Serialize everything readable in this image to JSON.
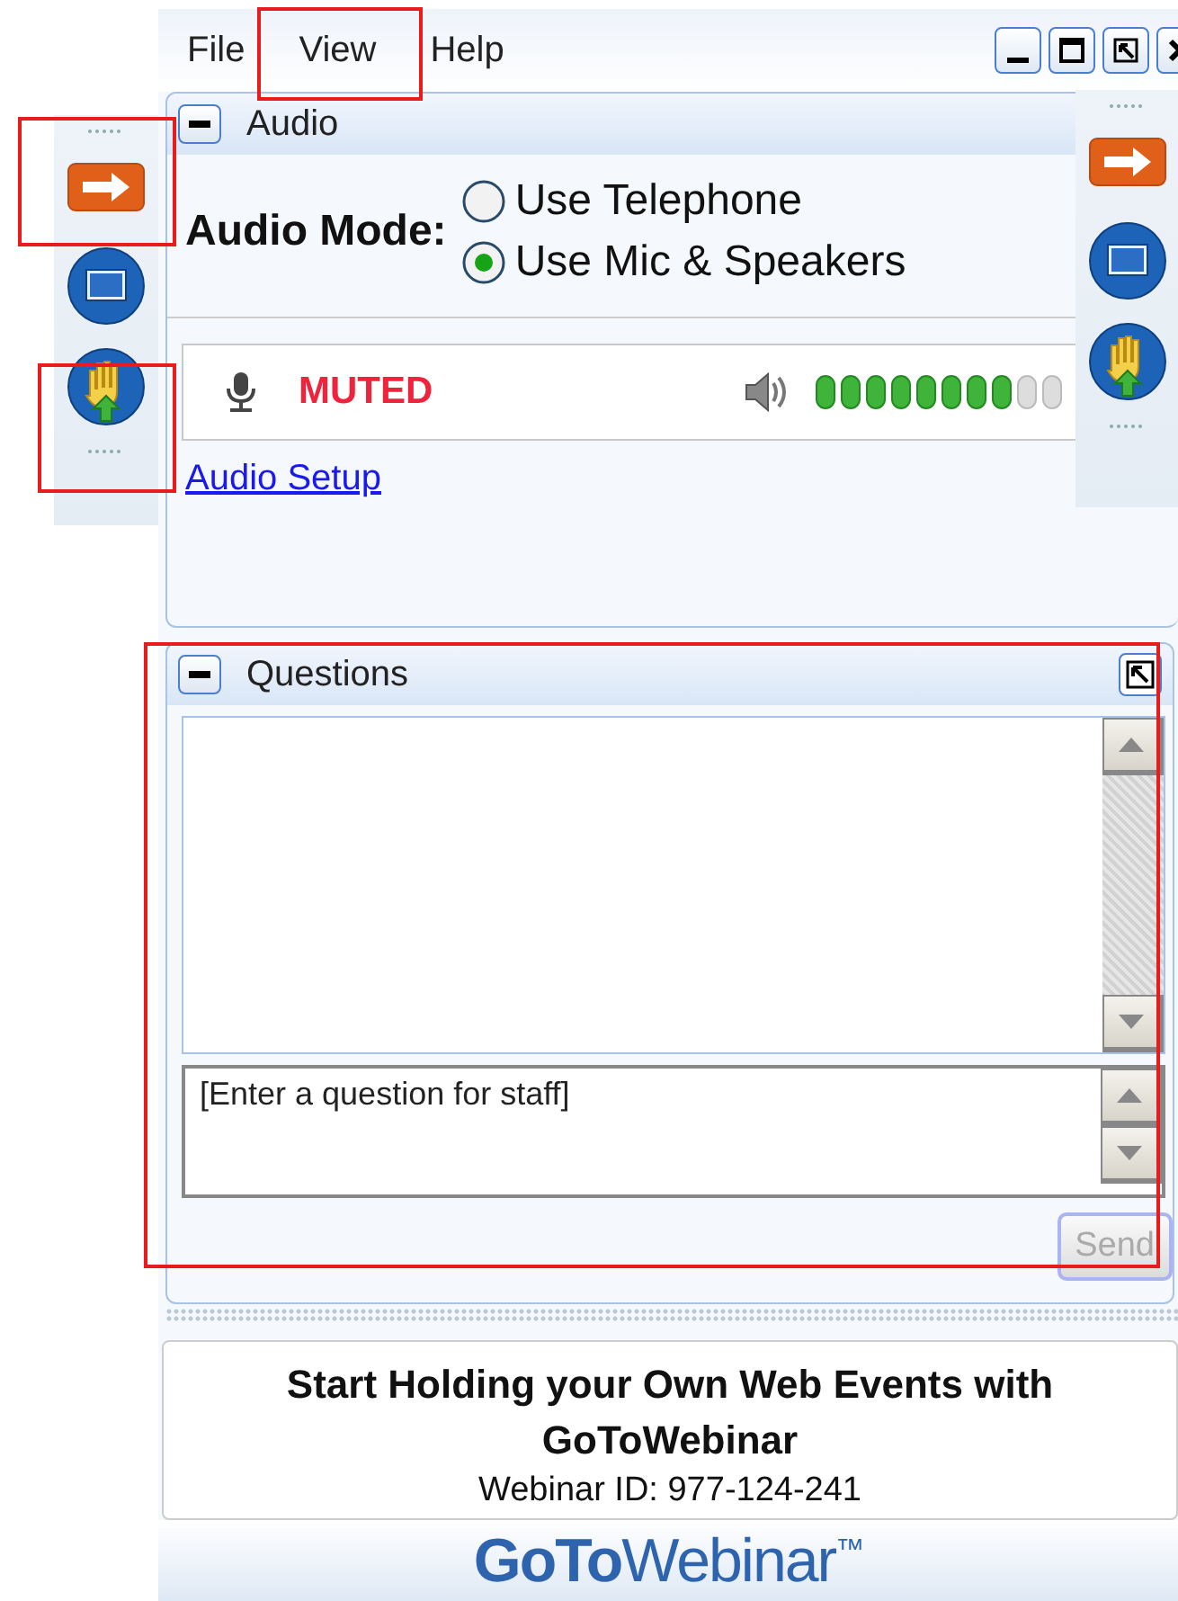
{
  "menu": [
    {
      "label": "File"
    },
    {
      "label": "View"
    },
    {
      "label": "Help"
    }
  ],
  "audio_panel": {
    "title": "Audio",
    "mode_label": "Audio Mode:",
    "options": [
      {
        "label": "Use Telephone",
        "selected": false
      },
      {
        "label": "Use Mic & Speakers",
        "selected": true
      }
    ],
    "mic": {
      "status": "MUTED",
      "muted": true
    },
    "speaker": {
      "level": 0.8
    },
    "setup_link": "Audio Setup"
  },
  "questions_panel": {
    "title": "Questions",
    "input": {
      "placeholder": "[Enter a question for staff]"
    },
    "send_button": {
      "label": "Send",
      "disabled": true
    }
  },
  "promo": {
    "headline": "Start Holding your Own Web Events with GoToWebinar",
    "webinar_id": "Webinar ID: 977-124-241"
  },
  "logo": "**GoTo**Webinar$^{™}$"
}
